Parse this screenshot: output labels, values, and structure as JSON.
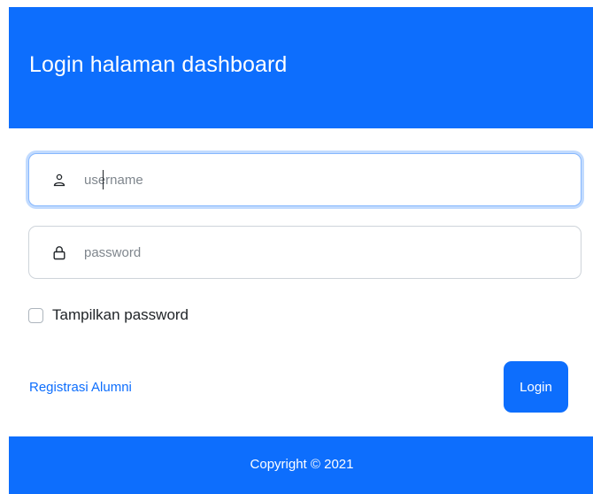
{
  "header": {
    "title": "Login halaman dashboard"
  },
  "form": {
    "username": {
      "value": "",
      "placeholder": "username",
      "icon": "user-icon"
    },
    "password": {
      "value": "",
      "placeholder": "password",
      "icon": "lock-icon"
    },
    "show_password": {
      "label": "Tampilkan password",
      "checked": false
    }
  },
  "actions": {
    "register_link": "Registrasi Alumni",
    "login_button": "Login"
  },
  "footer": {
    "copyright": "Copyright © 2021"
  },
  "colors": {
    "primary": "#0d6efd",
    "focus_border": "#86b7fe"
  }
}
